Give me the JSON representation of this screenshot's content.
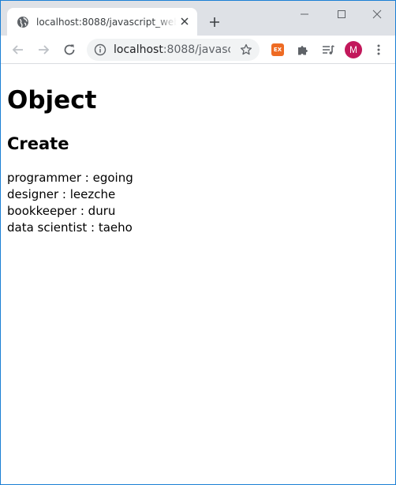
{
  "browser": {
    "tab": {
      "title": "localhost:8088/javascript_web_pr",
      "favicon": "globe-icon"
    },
    "new_tab_label": "+",
    "address": {
      "host": "localhost",
      "rest": ":8088/javasc...",
      "info_icon": "info-icon",
      "star_icon": "star-icon"
    },
    "extension_ex_label": "EX",
    "avatar_initial": "M",
    "colors": {
      "tabstrip": "#dee1e6",
      "avatar": "#c2185b",
      "extension": "#ee6b23",
      "window_border": "#1b7fd4"
    }
  },
  "page": {
    "heading": "Object",
    "subheading": "Create",
    "items": [
      "programmer : egoing",
      "designer : leezche",
      "bookkeeper : duru",
      "data scientist : taeho"
    ]
  }
}
